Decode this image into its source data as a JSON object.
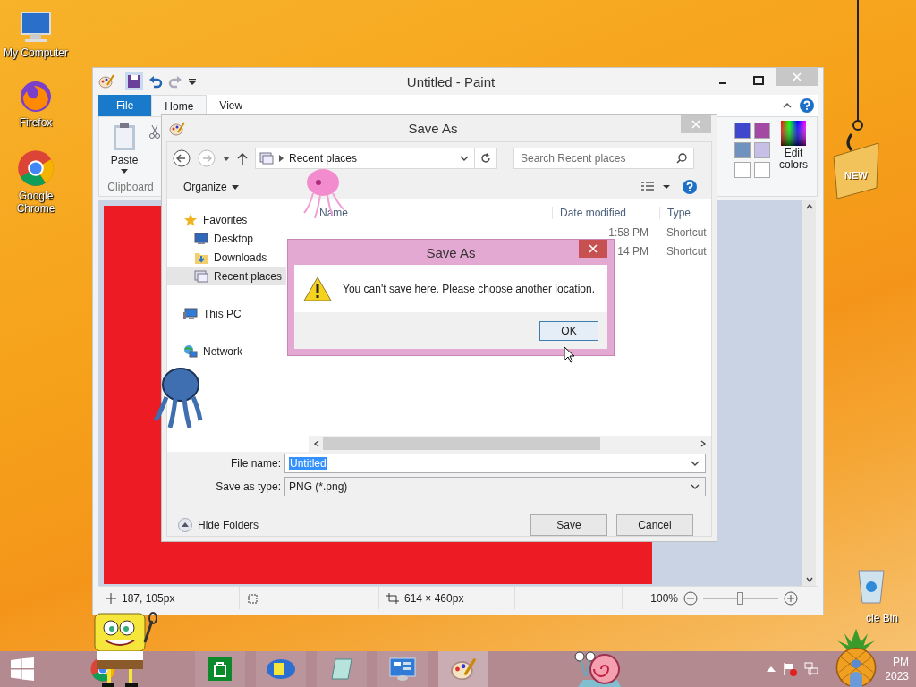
{
  "desktop": {
    "icons": [
      {
        "label": "My Computer",
        "kind": "computer"
      },
      {
        "label": "Firefox",
        "kind": "firefox"
      },
      {
        "label": "Google Chrome",
        "kind": "chrome"
      }
    ],
    "recycle_bin": "cle Bin",
    "tag": "NEW"
  },
  "paint": {
    "title": "Untitled - Paint",
    "tabs": [
      {
        "label": "File",
        "kind": "file",
        "selected": false
      },
      {
        "label": "Home",
        "kind": "tab",
        "selected": true
      },
      {
        "label": "View",
        "kind": "tab",
        "selected": false
      }
    ],
    "ribbon": {
      "paste": "Paste",
      "group": "Clipboard",
      "edit_colors": "Edit colors",
      "palette": [
        {
          "color": "#3f48cc"
        },
        {
          "color": "#a349a4"
        },
        {
          "color": "#7092be"
        },
        {
          "color": "#c8bfe7"
        }
      ]
    },
    "status": {
      "position": "187, 105px",
      "size": "614 × 460px",
      "zoom": "100%",
      "zoom_slider": {
        "level": 0.5
      }
    }
  },
  "save_as": {
    "title": "Save As",
    "path": "Recent places",
    "search": {
      "placeholder": "Search Recent places"
    },
    "organize": "Organize",
    "nav": [
      {
        "label": "Favorites",
        "kind": "favorites",
        "selected": false,
        "children": [
          {
            "label": "Desktop",
            "kind": "desktop",
            "selected": false
          },
          {
            "label": "Downloads",
            "kind": "downloads",
            "selected": false
          },
          {
            "label": "Recent places",
            "kind": "recent",
            "selected": true
          }
        ]
      },
      {
        "label": "This PC",
        "kind": "pc",
        "selected": false
      },
      {
        "label": "Network",
        "kind": "network",
        "selected": false
      }
    ],
    "columns": [
      "Name",
      "Date modified",
      "Type"
    ],
    "rows": [
      {
        "date": "1:58 PM",
        "type": "Shortcut"
      },
      {
        "date": "14 PM",
        "type": "Shortcut"
      }
    ],
    "file_name": {
      "label": "File name:",
      "value": "Untitled"
    },
    "file_type": {
      "label": "Save as type:",
      "value": "PNG (*.png)"
    },
    "hide_folders": "Hide Folders",
    "buttons": [
      "Save",
      "Cancel"
    ]
  },
  "message": {
    "title": "Save As",
    "text": "You can't save here. Please choose another location.",
    "button": "OK"
  },
  "taskbar": {
    "clock": [
      "PM",
      "2023"
    ]
  }
}
